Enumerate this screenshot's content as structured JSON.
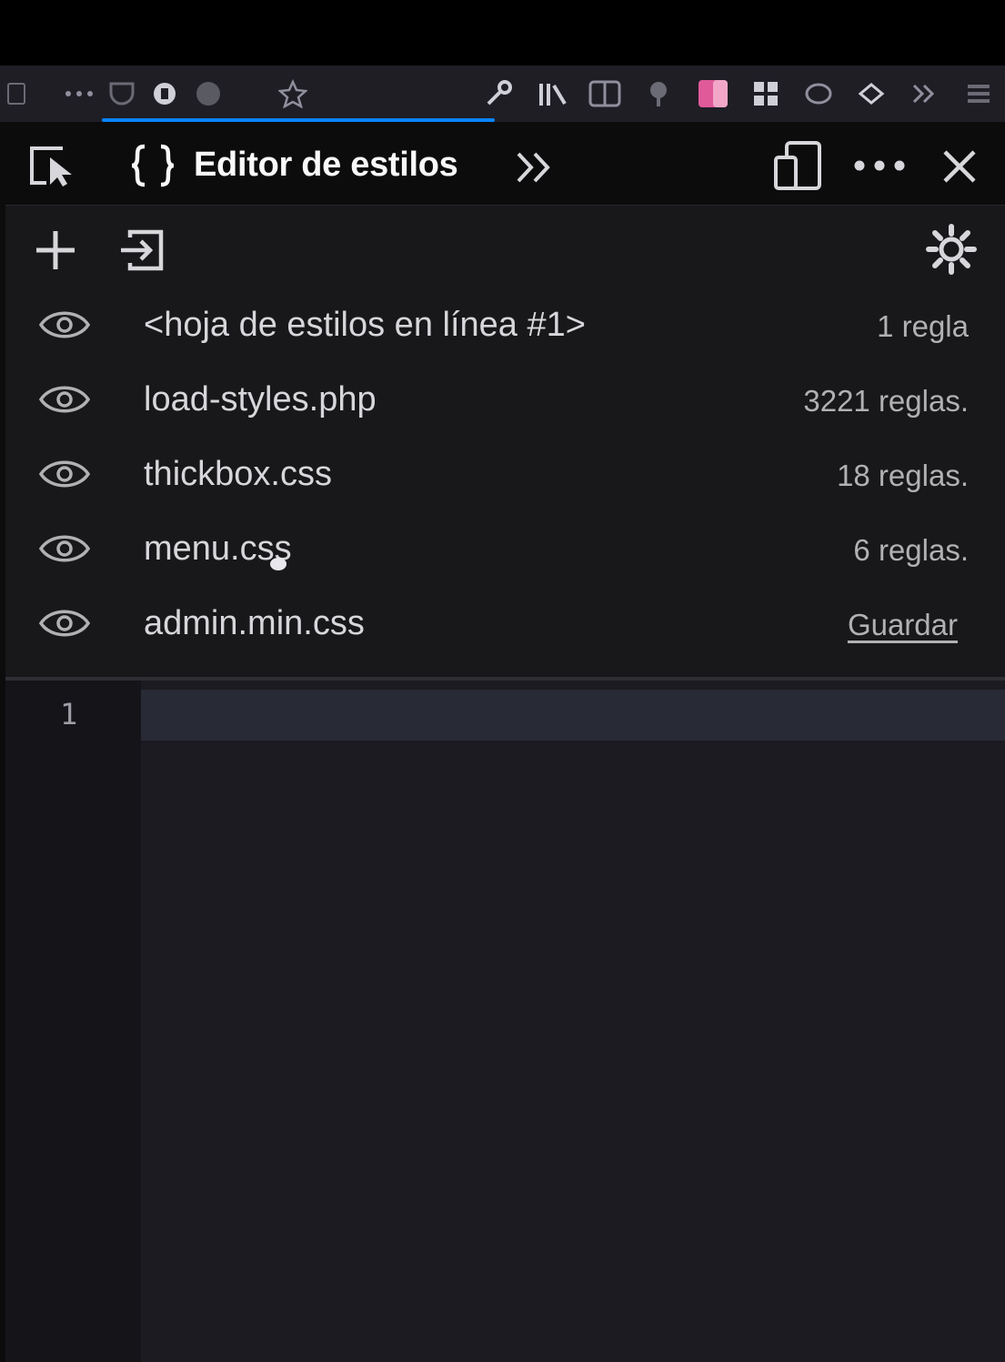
{
  "devtools": {
    "active_tab": "Editor de estilos",
    "tab_icon": "braces-icon",
    "overflow_tabs_symbol": "»"
  },
  "stylesheets": [
    {
      "name": "<hoja de estilos en línea #1>",
      "info": "1 regla"
    },
    {
      "name": "load-styles.php",
      "info": "3221 reglas."
    },
    {
      "name": "thickbox.css",
      "info": "18 reglas."
    },
    {
      "name": "menu.css",
      "info": "6 reglas."
    },
    {
      "name": "admin.min.css",
      "info": "Guardar"
    }
  ],
  "editor": {
    "line_number": "1"
  },
  "colors": {
    "accent": "#0a84ff",
    "panel_bg": "#18181a",
    "editor_bg": "#1c1b22"
  }
}
